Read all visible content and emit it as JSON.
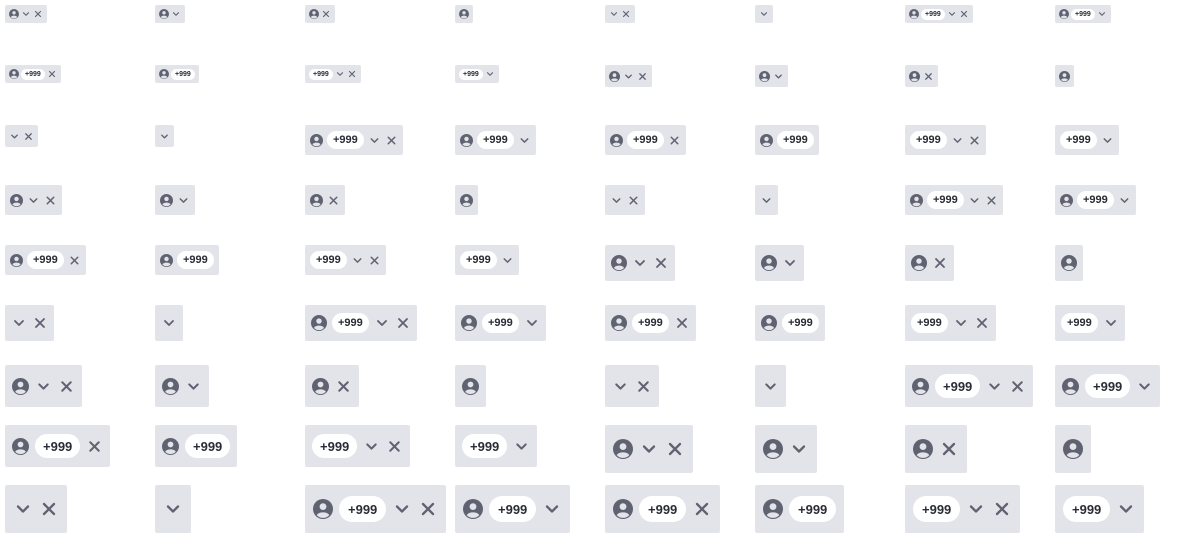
{
  "badge_text": "+999",
  "colors": {
    "chip_bg": "#e3e4ea",
    "icon": "#5f6270",
    "badge_bg": "#ffffff",
    "badge_text": "#2b2d36"
  },
  "icons": {
    "avatar": "user-avatar-icon",
    "dropdown": "chevron-down-icon",
    "remove": "close-icon"
  }
}
